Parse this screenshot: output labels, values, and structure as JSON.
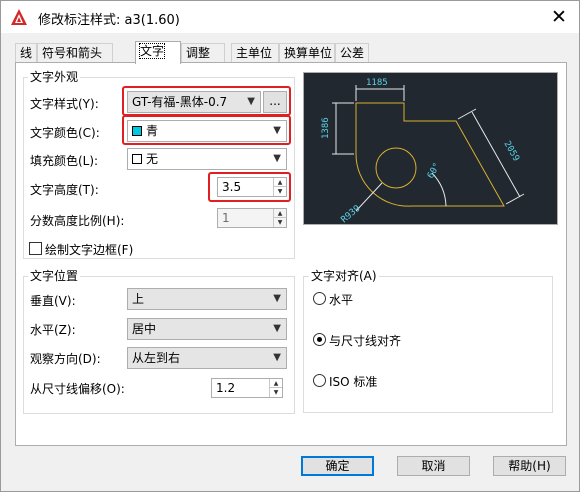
{
  "window": {
    "title": "修改标注样式: a3(1.60)"
  },
  "tabs": [
    "线",
    "符号和箭头",
    "文字",
    "调整",
    "主单位",
    "换算单位",
    "公差"
  ],
  "text_appearance": {
    "group_label": "文字外观",
    "style_label": "文字样式(Y):",
    "style_value": "GT-有福-黑体-0.7",
    "style_browse": "...",
    "color_label": "文字颜色(C):",
    "color_value": "青",
    "fill_label": "填充颜色(L):",
    "fill_value": "无",
    "height_label": "文字高度(T):",
    "height_value": "3.5",
    "fraction_label": "分数高度比例(H):",
    "fraction_value": "1",
    "frame_label": "绘制文字边框(F)"
  },
  "text_placement": {
    "group_label": "文字位置",
    "vertical_label": "垂直(V):",
    "vertical_value": "上",
    "horizontal_label": "水平(Z):",
    "horizontal_value": "居中",
    "direction_label": "观察方向(D):",
    "direction_value": "从左到右",
    "offset_label": "从尺寸线偏移(O):",
    "offset_value": "1.2"
  },
  "text_alignment": {
    "group_label": "文字对齐(A)",
    "options": [
      "水平",
      "与尺寸线对齐",
      "ISO 标准"
    ],
    "selected": "与尺寸线对齐"
  },
  "preview": {
    "dim_top": "1185",
    "dim_left": "1386",
    "dim_right": "2059",
    "dim_angle": "60°",
    "dim_radius": "R939"
  },
  "buttons": {
    "ok": "确定",
    "cancel": "取消",
    "help": "帮助(H)"
  },
  "colors": {
    "accent": "#0078d7",
    "highlight": "#e02020",
    "cyan": "#00c8e0",
    "preview_bg": "#212830",
    "preview_line": "#d8b030",
    "dim_line": "#e8e8e8",
    "dim_text": "#5ad2e6"
  }
}
